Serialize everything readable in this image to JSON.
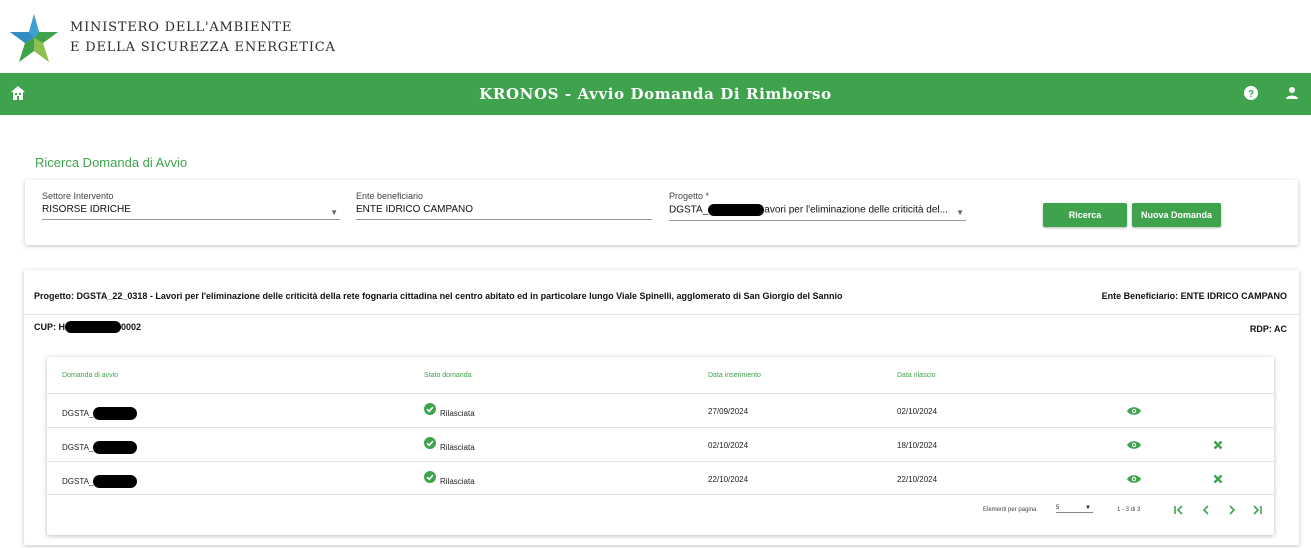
{
  "brand": {
    "line1": "MINISTERO DELL'AMBIENTE",
    "line2": "E DELLA SICUREZZA ENERGETICA"
  },
  "topbar": {
    "title": "KRONOS - Avvio Domanda Di Rimborso",
    "color": "#3fa34d"
  },
  "search": {
    "section_title": "Ricerca Domanda di Avvio",
    "settore_label": "Settore Intervento",
    "settore_value": "RISORSE IDRICHE",
    "ente_label": "Ente beneficiario",
    "ente_value": "ENTE IDRICO CAMPANO",
    "progetto_label": "Progetto *",
    "progetto_prefix": "DGSTA_",
    "progetto_suffix": "avori per l'eliminazione delle criticità del...",
    "btn_ricerca": "Ricerca",
    "btn_nuova": "Nuova Domanda"
  },
  "project": {
    "progetto_text": "Progetto:  DGSTA_22_0318 - Lavori per l'eliminazione delle criticità della rete fognaria cittadina nel centro abitato ed in particolare lungo Viale Spinelli, agglomerato di San Giorgio del Sannio",
    "ente_text": "Ente Beneficiario:  ENTE IDRICO CAMPANO",
    "cup_prefix": "CUP: H",
    "cup_suffix": "0002",
    "rdp_text": "RDP: AC"
  },
  "table": {
    "headers": {
      "domanda": "Domanda di avvio",
      "stato": "Stato domanda",
      "inserimento": "Data inserimento",
      "rilascio": "Data rilascio"
    },
    "rows": [
      {
        "domanda": "DGSTA_",
        "stato": "Rilasciata",
        "inserimento": "27/09/2024",
        "rilascio": "02/10/2024"
      },
      {
        "domanda": "DGSTA_",
        "stato": "Rilasciata",
        "inserimento": "02/10/2024",
        "rilascio": "18/10/2024"
      },
      {
        "domanda": "DGSTA_",
        "stato": "Rilasciata",
        "inserimento": "22/10/2024",
        "rilascio": "22/10/2024"
      }
    ],
    "pager": {
      "label": "Elementi per pagina",
      "page_size": "5",
      "range": "1 - 3 di 3"
    }
  }
}
